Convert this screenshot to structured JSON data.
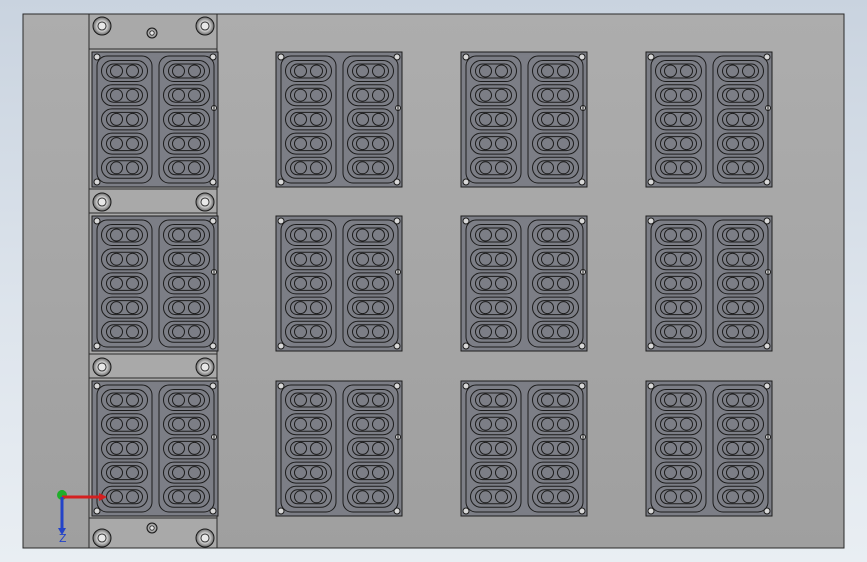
{
  "viewport": {
    "background_top": "#c9d3df",
    "background_bottom": "#e9eef3",
    "plate_color": "#a6a6a6",
    "strip_color": "#a9a9a9",
    "module_color": "#7c7e86",
    "outline_color": "#1c1c1c"
  },
  "layout": {
    "module_rows": 3,
    "module_columns": 4,
    "pads_per_module_column": 5,
    "pad_columns_per_module": 2
  },
  "triad": {
    "x_label": "",
    "y_label": "",
    "z_label": "Z",
    "x_icon": "axis-x-arrow-icon",
    "y_icon": "axis-y-arrow-icon",
    "z_icon": "axis-z-arrow-icon",
    "x_color": "#d42020",
    "y_color": "#1fae2a",
    "z_color": "#2343c8"
  }
}
